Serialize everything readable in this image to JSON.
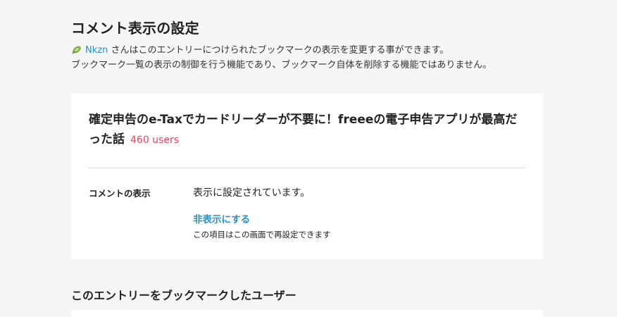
{
  "page": {
    "title": "コメント表示の設定"
  },
  "description": {
    "user_name": "Nkzn",
    "line1_suffix": " さんはこのエントリーにつけられたブックマークの表示を変更する事ができます。",
    "line2": "ブックマーク一覧の表示の制御を行う機能であり、ブックマーク自体を削除する機能ではありません。"
  },
  "entry": {
    "title": "確定申告のe-Taxでカードリーダーが不要に！freeeの電子申告アプリが最高だった話",
    "users": "460 users"
  },
  "comment_setting": {
    "label": "コメントの表示",
    "status": "表示に設定されています。",
    "hide_link": "非表示にする",
    "note": "この項目はこの画面で再設定できます"
  },
  "users_section": {
    "title": "このエントリーをブックマークしたユーザー"
  },
  "colors": {
    "background": "#f5f5f5",
    "link": "#2a8fc5",
    "users_count": "#f1415c"
  },
  "icons": {
    "user_avatar": "leaf-avatar-icon"
  }
}
